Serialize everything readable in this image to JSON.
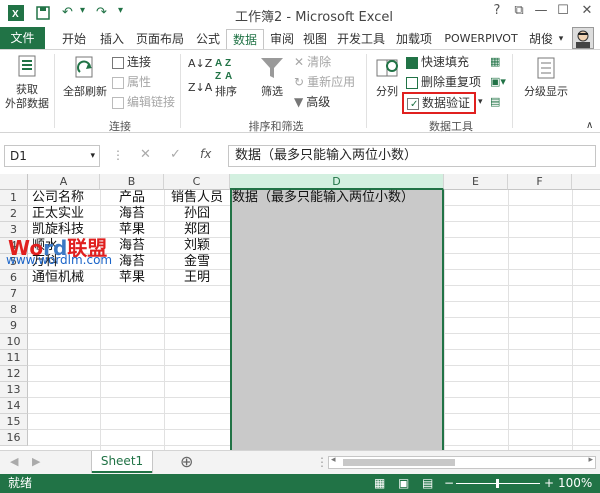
{
  "window": {
    "title": "工作簿2 - Microsoft Excel",
    "help": "?",
    "restore": "⧉",
    "minimize": "—",
    "maximize": "☐",
    "close": "✕"
  },
  "tabs": {
    "file": "文件",
    "items": [
      "开始",
      "插入",
      "页面布局",
      "公式",
      "数据",
      "审阅",
      "视图",
      "开发工具",
      "加载项",
      "POWERPIVOT"
    ],
    "active": "数据",
    "user": "胡俊"
  },
  "ribbon": {
    "get_external": "获取\n外部数据",
    "refresh_all": "全部刷新",
    "connections": "连接",
    "properties": "属性",
    "edit_links": "编辑链接",
    "group_connections": "连接",
    "sort": "排序",
    "filter": "筛选",
    "clear": "清除",
    "reapply": "重新应用",
    "advanced": "高级",
    "group_sort_filter": "排序和筛选",
    "text_to_columns": "分列",
    "flash_fill": "快速填充",
    "remove_duplicates": "删除重复项",
    "data_validation": "数据验证",
    "group_data_tools": "数据工具",
    "outline": "分级显示"
  },
  "formula_bar": {
    "name_box": "D1",
    "fx": "fx",
    "content": "数据（最多只能输入两位小数）"
  },
  "sheet": {
    "columns": [
      "A",
      "B",
      "C",
      "D",
      "E",
      "F"
    ],
    "selected_column": "D",
    "rows": [
      "1",
      "2",
      "3",
      "4",
      "5",
      "6",
      "7",
      "8",
      "9",
      "10",
      "11",
      "12",
      "13",
      "14",
      "15",
      "16"
    ],
    "data": [
      [
        "公司名称",
        "产品",
        "销售人员",
        "数据（最多只能输入两位小数）"
      ],
      [
        "正太实业",
        "海苔",
        "孙囧",
        ""
      ],
      [
        "凯旋科技",
        "苹果",
        "郑团",
        ""
      ],
      [
        "顺水",
        "海苔",
        "刘颖",
        ""
      ],
      [
        "万科",
        "海苔",
        "金雪",
        ""
      ],
      [
        "通恒机械",
        "苹果",
        "王明",
        ""
      ]
    ]
  },
  "sheetbar": {
    "tab": "Sheet1",
    "add": "⊕"
  },
  "status": {
    "ready": "就绪",
    "zoom": "100%",
    "minus": "−",
    "plus": "+"
  },
  "watermark": {
    "brand": "Word联盟",
    "url": "www.wordlm.com"
  },
  "colors": {
    "accent": "#217346",
    "highlight": "#e0201f"
  }
}
